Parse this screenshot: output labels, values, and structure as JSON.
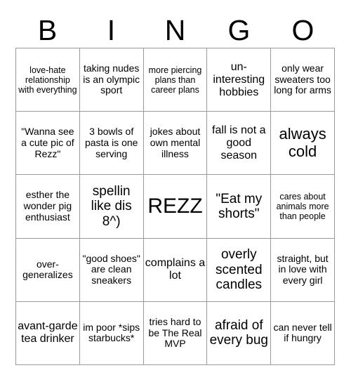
{
  "card": {
    "header_letters": [
      "B",
      "I",
      "N",
      "G",
      "O"
    ],
    "columns": 5,
    "rows": 5,
    "free_space_index": 12,
    "border_color": "#9a9a9a",
    "background_color": "#ffffff",
    "text_color": "#000000",
    "cells": [
      {
        "text": "love-hate relationship with everything",
        "size": "xs"
      },
      {
        "text": "taking nudes is an olympic sport",
        "size": "s"
      },
      {
        "text": "more piercing plans than career plans",
        "size": "xs"
      },
      {
        "text": "un-interesting hobbies",
        "size": "m"
      },
      {
        "text": "only wear sweaters too long for arms",
        "size": "s"
      },
      {
        "text": "\"Wanna see a cute pic of Rezz\"",
        "size": "s"
      },
      {
        "text": "3 bowls of pasta is one serving",
        "size": "s"
      },
      {
        "text": "jokes about own mental illness",
        "size": "s"
      },
      {
        "text": "fall is not a good season",
        "size": "m"
      },
      {
        "text": "always cold",
        "size": "xl"
      },
      {
        "text": "esther the wonder pig enthusiast",
        "size": "s"
      },
      {
        "text": "spellin like dis 8^)",
        "size": "l"
      },
      {
        "text": "REZZ",
        "size": "free"
      },
      {
        "text": "\"Eat my shorts\"",
        "size": "l"
      },
      {
        "text": "cares about animals more than people",
        "size": "xs"
      },
      {
        "text": "over-generalizes",
        "size": "s"
      },
      {
        "text": "\"good shoes\" are clean sneakers",
        "size": "s"
      },
      {
        "text": "complains a lot",
        "size": "m"
      },
      {
        "text": "overly scented candles",
        "size": "l"
      },
      {
        "text": "straight, but in love with every girl",
        "size": "s"
      },
      {
        "text": "avant-garde tea drinker",
        "size": "m"
      },
      {
        "text": "im poor *sips starbucks*",
        "size": "s"
      },
      {
        "text": "tries hard to be The Real MVP",
        "size": "s"
      },
      {
        "text": "afraid of every bug",
        "size": "l"
      },
      {
        "text": "can never tell if hungry",
        "size": "s"
      }
    ]
  }
}
